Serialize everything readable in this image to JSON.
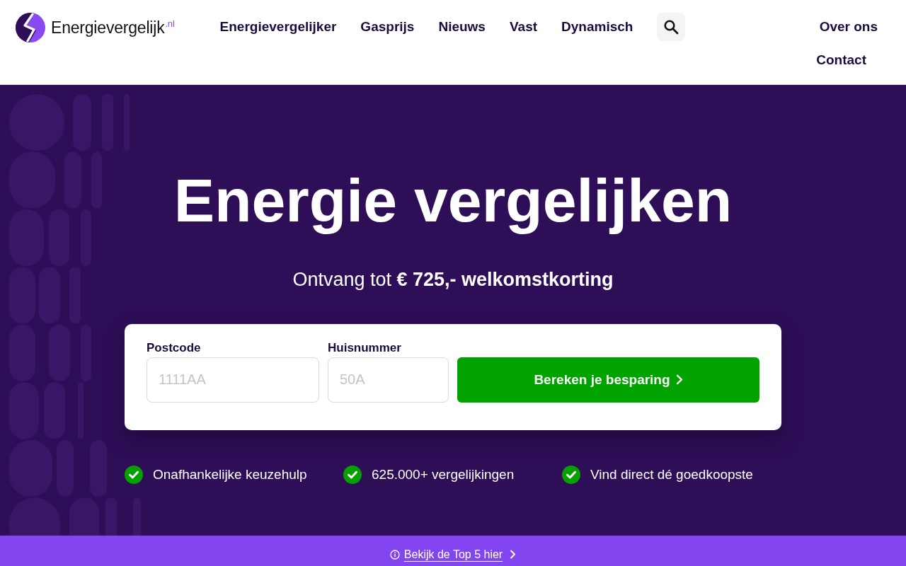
{
  "header": {
    "logo": {
      "name": "Energievergelijk",
      "suffix": ".nl"
    },
    "nav": [
      "Energievergelijker",
      "Gasprijs",
      "Nieuws",
      "Vast",
      "Dynamisch"
    ],
    "secondary_nav": [
      "Over ons",
      "Contact"
    ]
  },
  "hero": {
    "title": "Energie vergelijken",
    "subtitle": "Ontvang tot **€ 725,- welkomstkorting**",
    "form": {
      "fields": [
        {
          "label": "Postcode",
          "placeholder": "1111AA"
        },
        {
          "label": "Huisnummer",
          "placeholder": "50A"
        }
      ],
      "submit": "Bereken je besparing"
    },
    "usps": [
      "Onafhankelijke keuzehulp",
      "625.000+ vergelijkingen",
      "Vind direct dé goedkoopste"
    ]
  },
  "banner": {
    "link": "Bekijk de Top 5 hier"
  }
}
